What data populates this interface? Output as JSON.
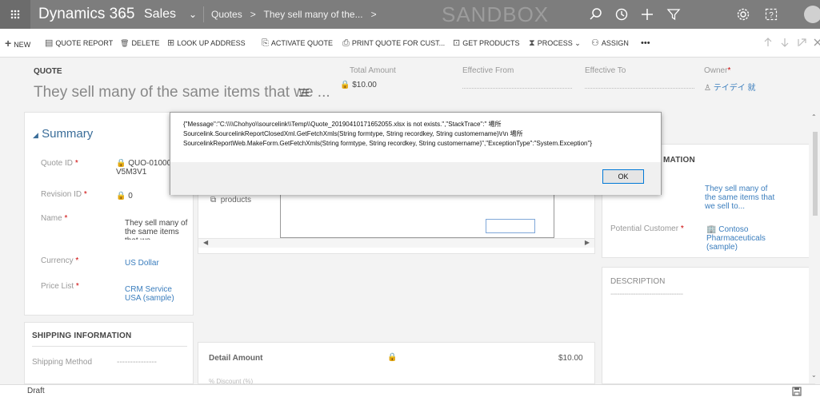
{
  "topnav": {
    "app_title": "Dynamics 365",
    "app_caret": "⌄",
    "area": "Sales",
    "area_caret": "⌄",
    "breadcrumb_entity": "Quotes",
    "breadcrumb_arrow": ">",
    "breadcrumb_record": "They sell many of the...",
    "breadcrumb_more": ">",
    "environment_label": "SANDBOX"
  },
  "commandbar": {
    "items": [
      {
        "icon": "+",
        "label": "NEW"
      },
      {
        "icon": "▤",
        "label": "QUOTE REPORT"
      },
      {
        "icon": "🗑",
        "label": "DELETE"
      },
      {
        "icon": "⊞",
        "label": "LOOK UP ADDRESS"
      },
      {
        "icon": "⎘",
        "label": "ACTIVATE QUOTE"
      },
      {
        "icon": "⎙",
        "label": "PRINT QUOTE FOR CUST..."
      },
      {
        "icon": "⊡",
        "label": "GET PRODUCTS"
      },
      {
        "icon": "⧗",
        "label": "PROCESS ⌄"
      },
      {
        "icon": "⚇",
        "label": "ASSIGN"
      },
      {
        "icon": "",
        "label": "•••"
      }
    ]
  },
  "header": {
    "entity_type": "QUOTE",
    "title": "They sell many of the same items that we ...",
    "total_amount_label": "Total Amount",
    "total_amount_value": "$10.00",
    "effective_from_label": "Effective From",
    "effective_to_label": "Effective To",
    "owner_label": "Owner",
    "owner_value": "テイデイ 就"
  },
  "summary": {
    "title": "Summary",
    "fields": [
      {
        "label": "Quote ID",
        "value": "QUO-01000-V5M3V1"
      },
      {
        "label": "Revision ID",
        "value": "0"
      },
      {
        "label": "Name",
        "value": "They sell many of the same items that we..."
      },
      {
        "label": "Currency",
        "value": "US Dollar"
      },
      {
        "label": "Price List",
        "value": "CRM Service USA (sample)"
      }
    ]
  },
  "shipping": {
    "title": "SHIPPING INFORMATION",
    "method_label": "Shipping Method",
    "method_value": "---------------"
  },
  "products": {
    "label": "products",
    "detail_amount_label": "Detail Amount",
    "detail_amount_value": "$10.00",
    "cut_row_text": "% Discount (%)"
  },
  "right_panel": {
    "section_title": "MATION",
    "topic_value": "They sell many of the same items that we sell to...",
    "potential_customer_label": "Potential Customer",
    "potential_customer_value": "Contoso Pharmaceuticals (sample)",
    "description_label": "DESCRIPTION",
    "description_value": "--------------------------------"
  },
  "dialog": {
    "message": "{\"Message\":\"C:\\\\\\\\Chohyo\\\\sourcelink\\\\Temp\\\\Quote_20190410171652055.xlsx is not exists.\",\"StackTrace\":\"   場所 Sourcelink.SourcelinkReportClosedXml.GetFetchXmls(String formtype, String recordkey, String customername)\\r\\n   場所 SourcelinkReportWeb.MakeForm.GetFetchXmls(String formtype, String recordkey, String customername)\",\"ExceptionType\":\"System.Exception\"}",
    "ok_label": "OK"
  },
  "status": {
    "text": "Draft"
  },
  "colors": {
    "nav_bg": "#7d7d7d",
    "link": "#3a7dbd",
    "section_title": "#3a6d99",
    "required": "#cc0000"
  }
}
